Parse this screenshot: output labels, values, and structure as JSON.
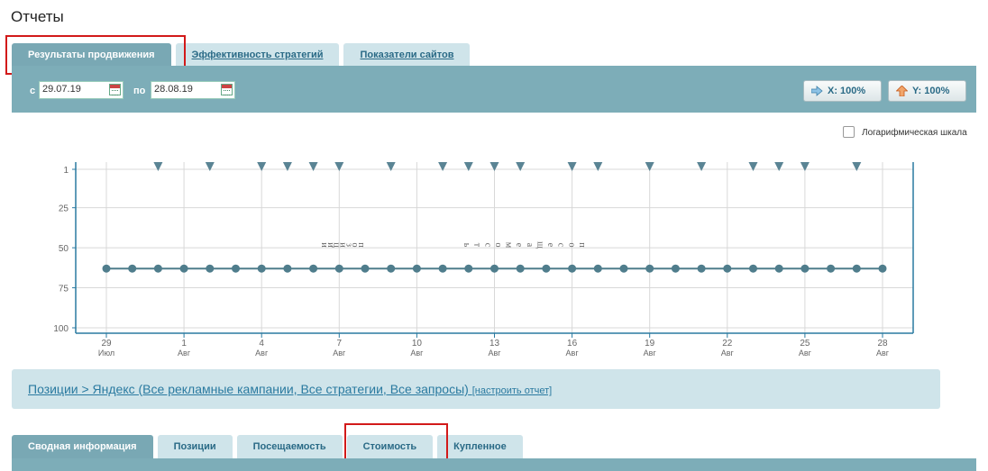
{
  "page": {
    "title": "Отчеты"
  },
  "tabs": [
    {
      "label": "Результаты продвижения",
      "active": true
    },
    {
      "label": "Эффективность стратегий",
      "active": false
    },
    {
      "label": "Показатели сайтов",
      "active": false
    }
  ],
  "filter": {
    "from_label": "с",
    "from_value": "29.07.19",
    "to_label": "по",
    "to_value": "28.08.19",
    "zoom_x_label": "X: 100%",
    "zoom_y_label": "Y: 100%"
  },
  "log_scale": {
    "label": "Логарифмическая шкала",
    "checked": false
  },
  "chart_data": {
    "type": "line",
    "y_ticks": [
      "1",
      "25",
      "50",
      "75",
      "100"
    ],
    "ylim": [
      1,
      100
    ],
    "y_reversed": true,
    "x_tick_labels": [
      [
        "29",
        "Июл"
      ],
      [
        "1",
        "Авг"
      ],
      [
        "4",
        "Авг"
      ],
      [
        "7",
        "Авг"
      ],
      [
        "10",
        "Авг"
      ],
      [
        "13",
        "Авг"
      ],
      [
        "16",
        "Авг"
      ],
      [
        "19",
        "Авг"
      ],
      [
        "22",
        "Авг"
      ],
      [
        "25",
        "Авг"
      ],
      [
        "28",
        "Авг"
      ]
    ],
    "x_start": "2019-07-29",
    "x_end": "2019-08-28",
    "series": [
      {
        "values": [
          63,
          63,
          63,
          63,
          63,
          63,
          63,
          63,
          63,
          63,
          63,
          63,
          63,
          63,
          63,
          63,
          63,
          63,
          63,
          63,
          63,
          63,
          63,
          63,
          63,
          63,
          63,
          63,
          63,
          63,
          63
        ]
      }
    ],
    "event_markers_dates": [
      "2019-07-31",
      "2019-08-02",
      "2019-08-04",
      "2019-08-05",
      "2019-08-06",
      "2019-08-07",
      "2019-08-09",
      "2019-08-11",
      "2019-08-12",
      "2019-08-13",
      "2019-08-14",
      "2019-08-16",
      "2019-08-17",
      "2019-08-19",
      "2019-08-21",
      "2019-08-23",
      "2019-08-24",
      "2019-08-25",
      "2019-08-27"
    ],
    "annotations": [
      "позиции",
      "посещаемость"
    ],
    "colors": {
      "line": "#4f7d8c",
      "marker": "#5a8494",
      "axis": "#2a7aa0",
      "grid": "#d8d8d8"
    }
  },
  "info": {
    "text": "Позиции > Яндекс (Все рекламные кампании, Все стратегии, Все запросы)",
    "link": "[настроить отчет]"
  },
  "tabs_bottom": [
    {
      "label": "Сводная информация",
      "active": true
    },
    {
      "label": "Позиции",
      "active": false
    },
    {
      "label": "Посещаемость",
      "active": false
    },
    {
      "label": "Стоимость",
      "active": false
    },
    {
      "label": "Купленное",
      "active": false
    }
  ],
  "colors": {
    "toolbar": "#7dadb8",
    "tab_inactive": "#cfe4ea",
    "tab_active": "#79a8b4",
    "highlight": "#d21a1a"
  }
}
